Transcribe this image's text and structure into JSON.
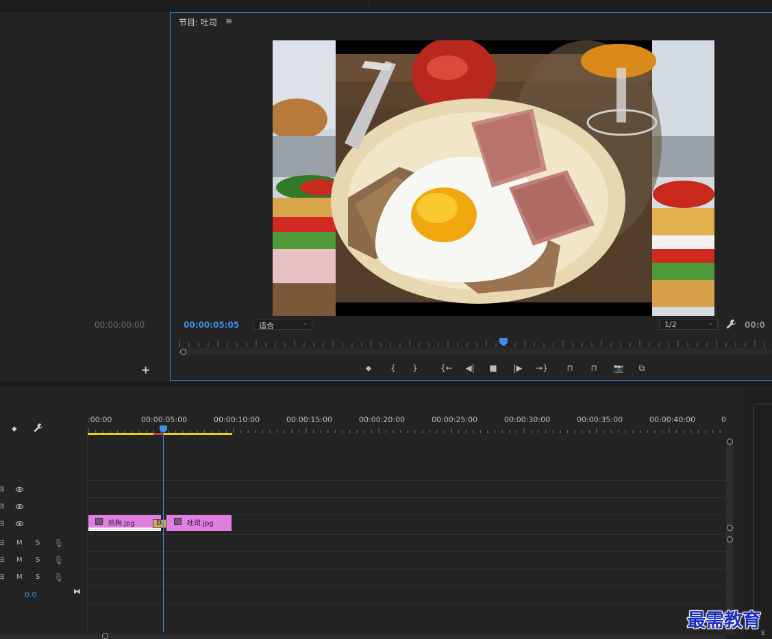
{
  "source_monitor": {
    "timecode": "00:00:00:00",
    "add_label": "+"
  },
  "program_monitor": {
    "title": "节目: 吐司",
    "menu_glyph": "≡",
    "timecode": "00:00:05:05",
    "zoom_select": "适合",
    "resolution_select": "1/2",
    "timecode_right": "00:0",
    "playhead_fraction": 0.55
  },
  "transport_controls": [
    {
      "name": "add-marker-button",
      "glyph": "⬥"
    },
    {
      "name": "mark-in-button",
      "glyph": "{"
    },
    {
      "name": "mark-out-button",
      "glyph": "}"
    },
    {
      "name": "go-to-in-button",
      "glyph": "{←"
    },
    {
      "name": "step-back-button",
      "glyph": "◀|"
    },
    {
      "name": "stop-button",
      "glyph": "■"
    },
    {
      "name": "step-forward-button",
      "glyph": "|▶"
    },
    {
      "name": "go-to-out-button",
      "glyph": "→}"
    },
    {
      "name": "lift-button",
      "glyph": "⊓"
    },
    {
      "name": "extract-button",
      "glyph": "⊓"
    },
    {
      "name": "export-frame-button",
      "glyph": "📷"
    },
    {
      "name": "comparison-view-button",
      "glyph": "⧉"
    }
  ],
  "timeline": {
    "ruler_labels": [
      ":00:00",
      "00:00:05:00",
      "00:00:10:00",
      "00:00:15:00",
      "00:00:20:00",
      "00:00:25:00",
      "00:00:30:00",
      "00:00:35:00",
      "00:00:40:00",
      "0"
    ],
    "video_tracks": 3,
    "audio_tracks": [
      {
        "m": "M",
        "s": "S"
      },
      {
        "m": "M",
        "s": "S"
      },
      {
        "m": "M",
        "s": "S"
      }
    ],
    "master_volume": "0.0",
    "clips": [
      {
        "label": "热狗.jpg"
      },
      {
        "label": "吐司.jpg"
      }
    ],
    "transition_label": "跃"
  },
  "watermark": "最需教育",
  "colors": {
    "accent": "#3f8fe6",
    "clip": "#e07fe0",
    "work_area": "#e8d400"
  }
}
